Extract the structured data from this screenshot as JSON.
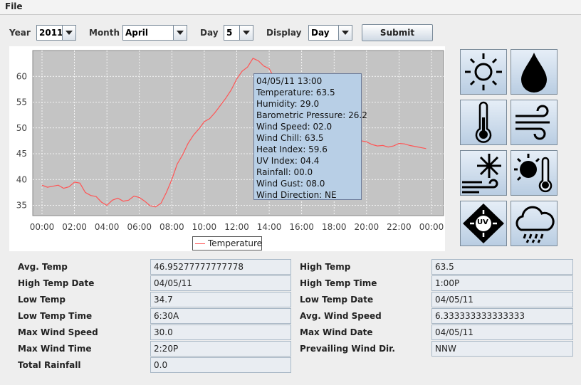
{
  "menu": {
    "file": "File"
  },
  "controls": {
    "year_label": "Year",
    "year_value": "2011",
    "month_label": "Month",
    "month_value": "April",
    "day_label": "Day",
    "day_value": "5",
    "display_label": "Display",
    "display_value": "Day",
    "submit_label": "Submit"
  },
  "chart_data": {
    "type": "line",
    "series": [
      {
        "name": "Temperature",
        "color": "#ff5555",
        "x": [
          "00:00",
          "00:20",
          "00:40",
          "01:00",
          "01:20",
          "01:40",
          "02:00",
          "02:20",
          "02:40",
          "03:00",
          "03:20",
          "03:40",
          "04:00",
          "04:20",
          "04:40",
          "05:00",
          "05:20",
          "05:40",
          "06:00",
          "06:20",
          "06:40",
          "07:00",
          "07:20",
          "07:40",
          "08:00",
          "08:20",
          "08:40",
          "09:00",
          "09:20",
          "09:40",
          "10:00",
          "10:20",
          "10:40",
          "11:00",
          "11:20",
          "11:40",
          "12:00",
          "12:20",
          "12:40",
          "13:00",
          "13:20",
          "13:40",
          "14:00",
          "14:20",
          "14:40",
          "15:00",
          "15:20",
          "15:40",
          "16:00",
          "16:20",
          "16:40",
          "17:00",
          "17:20",
          "17:40",
          "18:00",
          "18:20",
          "18:40",
          "19:00",
          "19:20",
          "19:40",
          "20:00",
          "20:20",
          "20:40",
          "21:00",
          "21:20",
          "21:40",
          "22:00",
          "22:20",
          "22:40",
          "23:00",
          "23:20",
          "23:40"
        ],
        "values": [
          38.9,
          38.5,
          38.7,
          38.9,
          38.3,
          38.6,
          39.5,
          39.3,
          37.5,
          36.9,
          36.7,
          35.6,
          35.0,
          36.0,
          36.4,
          35.8,
          36.0,
          36.8,
          36.5,
          35.8,
          34.9,
          34.7,
          35.4,
          37.5,
          40.0,
          43.0,
          44.8,
          47.0,
          48.6,
          49.8,
          51.2,
          51.8,
          53.0,
          54.4,
          55.8,
          57.4,
          59.5,
          61.0,
          61.8,
          63.5,
          63.0,
          62.0,
          61.5,
          59.5,
          57.2,
          55.2,
          54.0,
          53.4,
          53.0,
          52.5,
          51.8,
          51.5,
          50.3,
          48.5,
          48.0,
          47.5,
          47.2,
          47.0,
          47.3,
          47.5,
          47.3,
          46.8,
          46.5,
          46.6,
          46.3,
          46.5,
          47.0,
          46.9,
          46.6,
          46.4,
          46.2,
          46.0
        ]
      }
    ],
    "x_ticks": [
      "00:00",
      "02:00",
      "04:00",
      "06:00",
      "08:00",
      "10:00",
      "12:00",
      "14:00",
      "16:00",
      "18:00",
      "20:00",
      "22:00",
      "00:00"
    ],
    "y_ticks": [
      35,
      40,
      45,
      50,
      55,
      60
    ],
    "ylim": [
      33,
      65
    ],
    "grid": true,
    "legend": "bottom-center",
    "tooltip": [
      "04/05/11 13:00",
      "Temperature: 63.5",
      "Humidity: 29.0",
      "Barometric Pressure: 26.2",
      "Wind Speed: 02.0",
      "Wind Chill: 63.5",
      "Heat Index: 59.6",
      "UV Index: 04.4",
      "Rainfall: 00.0",
      "Wind Gust: 08.0",
      "Wind Direction: NE"
    ]
  },
  "icons": [
    "sun-icon",
    "raindrop-icon",
    "thermometer-icon",
    "wind-icon",
    "wind-chill-icon",
    "heat-index-icon",
    "uv-index-icon",
    "rain-cloud-icon"
  ],
  "uv_text": "UV",
  "stats": [
    {
      "label": "Avg. Temp",
      "value": "46.95277777777778"
    },
    {
      "label": "High Temp Date",
      "value": "04/05/11"
    },
    {
      "label": "Low Temp",
      "value": "34.7"
    },
    {
      "label": "Low Temp Time",
      "value": "6:30A"
    },
    {
      "label": "Max Wind Speed",
      "value": "30.0"
    },
    {
      "label": "Max Wind Time",
      "value": "2:20P"
    },
    {
      "label": "Total Rainfall",
      "value": "0.0"
    },
    {
      "label": "High Temp",
      "value": "63.5"
    },
    {
      "label": "High Temp Time",
      "value": "1:00P"
    },
    {
      "label": "Low Temp Date",
      "value": "04/05/11"
    },
    {
      "label": "Avg. Wind Speed",
      "value": "6.333333333333333"
    },
    {
      "label": "Max Wind Date",
      "value": "04/05/11"
    },
    {
      "label": "Prevailing Wind Dir.",
      "value": "NNW"
    }
  ]
}
